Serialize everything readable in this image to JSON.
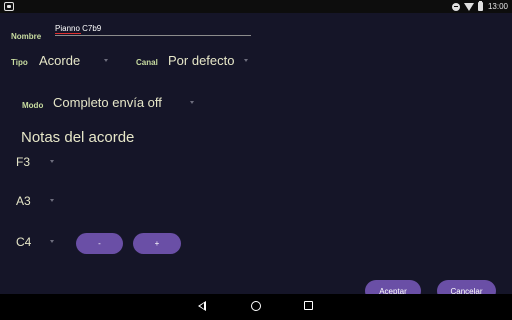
{
  "status_bar": {
    "time": "13:00"
  },
  "form": {
    "name_label": "Nombre",
    "name_value": "Pianno C7b9",
    "type_label": "Tipo",
    "type_value": "Acorde",
    "channel_label": "Canal",
    "channel_value": "Por defecto",
    "mode_label": "Modo",
    "mode_value": "Completo envía off"
  },
  "chord_notes": {
    "title": "Notas del acorde",
    "notes": [
      "F3",
      "A3",
      "C4"
    ],
    "remove_label": "-",
    "add_label": "+"
  },
  "actions": {
    "accept_label": "Aceptar",
    "cancel_label": "Cancelar"
  },
  "colors": {
    "background": "#151528",
    "button": "#6a4fa6",
    "label": "#c8dca0"
  }
}
